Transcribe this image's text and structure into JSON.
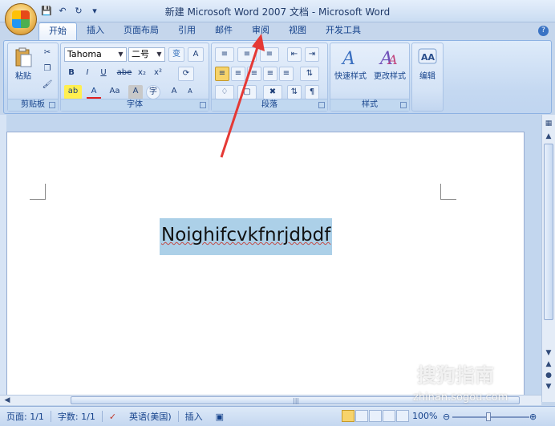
{
  "window": {
    "title": "新建 Microsoft Word 2007 文档 - Microsoft Word"
  },
  "quick_access": {
    "items": [
      "save-icon",
      "undo-icon",
      "redo-icon",
      "customize-icon"
    ]
  },
  "tabs": [
    {
      "label": "开始",
      "active": true
    },
    {
      "label": "插入"
    },
    {
      "label": "页面布局"
    },
    {
      "label": "引用"
    },
    {
      "label": "邮件"
    },
    {
      "label": "审阅"
    },
    {
      "label": "视图"
    },
    {
      "label": "开发工具"
    }
  ],
  "ribbon": {
    "clipboard": {
      "group_label": "剪贴板",
      "paste_label": "粘贴"
    },
    "font": {
      "group_label": "字体",
      "font_name": "Tahoma",
      "font_size": "二号",
      "bold": "B",
      "italic": "I",
      "underline": "U",
      "strike": "abe",
      "subscript": "x₂",
      "superscript": "x²",
      "highlight": "ab",
      "font_color": "A",
      "change_case": "Aa",
      "char_shading": "A",
      "grow_font": "A",
      "shrink_font": "A"
    },
    "paragraph": {
      "group_label": "段落"
    },
    "styles": {
      "group_label": "样式",
      "quick_styles": "快速样式",
      "change_styles": "更改样式"
    },
    "editing": {
      "label": "编辑"
    }
  },
  "document": {
    "selected_text": "Noighifcvkfnrjdbdf"
  },
  "status_bar": {
    "page": "页面: 1/1",
    "words": "字数: 1/1",
    "language": "英语(美国)",
    "mode": "插入",
    "zoom": "100%"
  },
  "watermark": {
    "brand": "搜狗指南",
    "url": "zhinan.sogou.com"
  },
  "colors": {
    "accent": "#15428b",
    "ribbon": "#c4d8f1",
    "selection": "#acd0e8",
    "annotation_arrow": "#e53935"
  }
}
